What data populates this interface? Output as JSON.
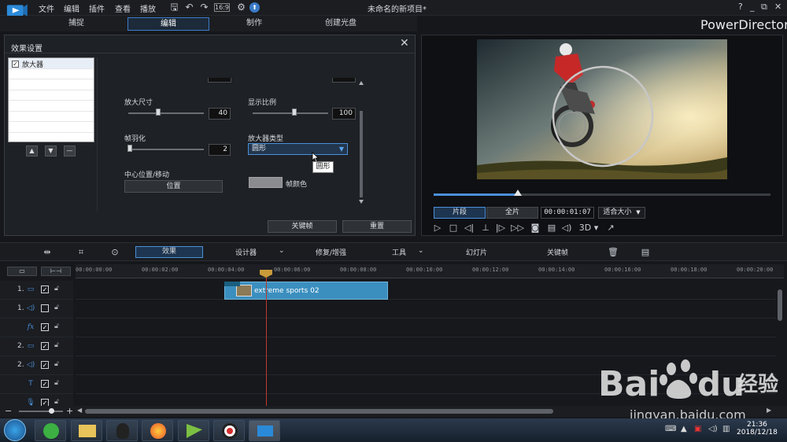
{
  "menu": {
    "file": "文件",
    "edit": "编辑",
    "plugins": "插件",
    "view": "查看",
    "play": "播放"
  },
  "window_title": "未命名的新项目*",
  "window_buttons": {
    "help": "?",
    "minimize": "_",
    "restore": "⧉",
    "close": "✕"
  },
  "tabs": [
    {
      "label": "捕捉",
      "active": false
    },
    {
      "label": "编辑",
      "active": true
    },
    {
      "label": "制作",
      "active": false
    },
    {
      "label": "创建光盘",
      "active": false
    }
  ],
  "brand": "PowerDirector",
  "effect_panel": {
    "title": "效果设置",
    "close": "✕",
    "list_items": [
      {
        "label": "放大器",
        "checked": true
      }
    ],
    "list_checkmark": "✓",
    "list_buttons": {
      "up": "▲",
      "down": "▼",
      "remove": "—"
    },
    "size": {
      "label": "放大尺寸",
      "value": "40",
      "level": 0.4
    },
    "ratio": {
      "label": "显示比例",
      "value": "100",
      "level": 0.55
    },
    "feather": {
      "label": "帧羽化",
      "value": "2",
      "level": 0.02
    },
    "magnifier_type": {
      "label": "放大器类型",
      "value": "圆形",
      "tooltip": "圆形"
    },
    "center": {
      "label": "中心位置/移动",
      "button": "位置"
    },
    "frame_color": {
      "label": "帧颜色",
      "color": "#8a8c8f"
    },
    "buttons": {
      "keyframe": "关键帧",
      "reset": "重置"
    }
  },
  "preview": {
    "mode_clip": "片段",
    "mode_movie": "全片",
    "timecode": "00:00:01:07",
    "fit": "适合大小",
    "fit_arrow": "▼",
    "three_d": "3D",
    "playhead_level": 0.25
  },
  "effects_bar": {
    "effect": "效果",
    "designer": "设计器",
    "repair": "修复/增强",
    "tools": "工具",
    "slideshow": "幻灯片",
    "keyframe": "关键帧",
    "dropdown_arrow": "⌄"
  },
  "timeline": {
    "ticks": [
      "00:00:00:00",
      "00:00:02:00",
      "00:00:04:00",
      "00:00:06:00",
      "00:00:08:00",
      "00:00:10:00",
      "00:00:12:00",
      "00:00:14:00",
      "00:00:16:00",
      "00:00:18:00",
      "00:00:20:00"
    ],
    "tracks": [
      {
        "num": "1.",
        "icon": "video-track-icon",
        "glyph": "▭",
        "checked": true
      },
      {
        "num": "1.",
        "icon": "audio-track-icon",
        "glyph": "◁)",
        "checked": false
      },
      {
        "num": "",
        "icon": "fx-track-icon",
        "glyph": "fx",
        "checked": true
      },
      {
        "num": "2.",
        "icon": "video-track-icon",
        "glyph": "▭",
        "checked": true
      },
      {
        "num": "2.",
        "icon": "audio-track-icon",
        "glyph": "◁)",
        "checked": true
      },
      {
        "num": "",
        "icon": "title-track-icon",
        "glyph": "T",
        "checked": true
      },
      {
        "num": "",
        "icon": "voice-track-icon",
        "glyph": "🎙",
        "checked": true
      }
    ],
    "clip": "extreme sports 02",
    "zoom_minus": "−",
    "zoom_plus": "+"
  },
  "taskbar": {
    "time": "21:36",
    "date": "2018/12/18"
  },
  "watermark": {
    "brand": "Bai du 经验",
    "url": "jingyan.baidu.com"
  }
}
